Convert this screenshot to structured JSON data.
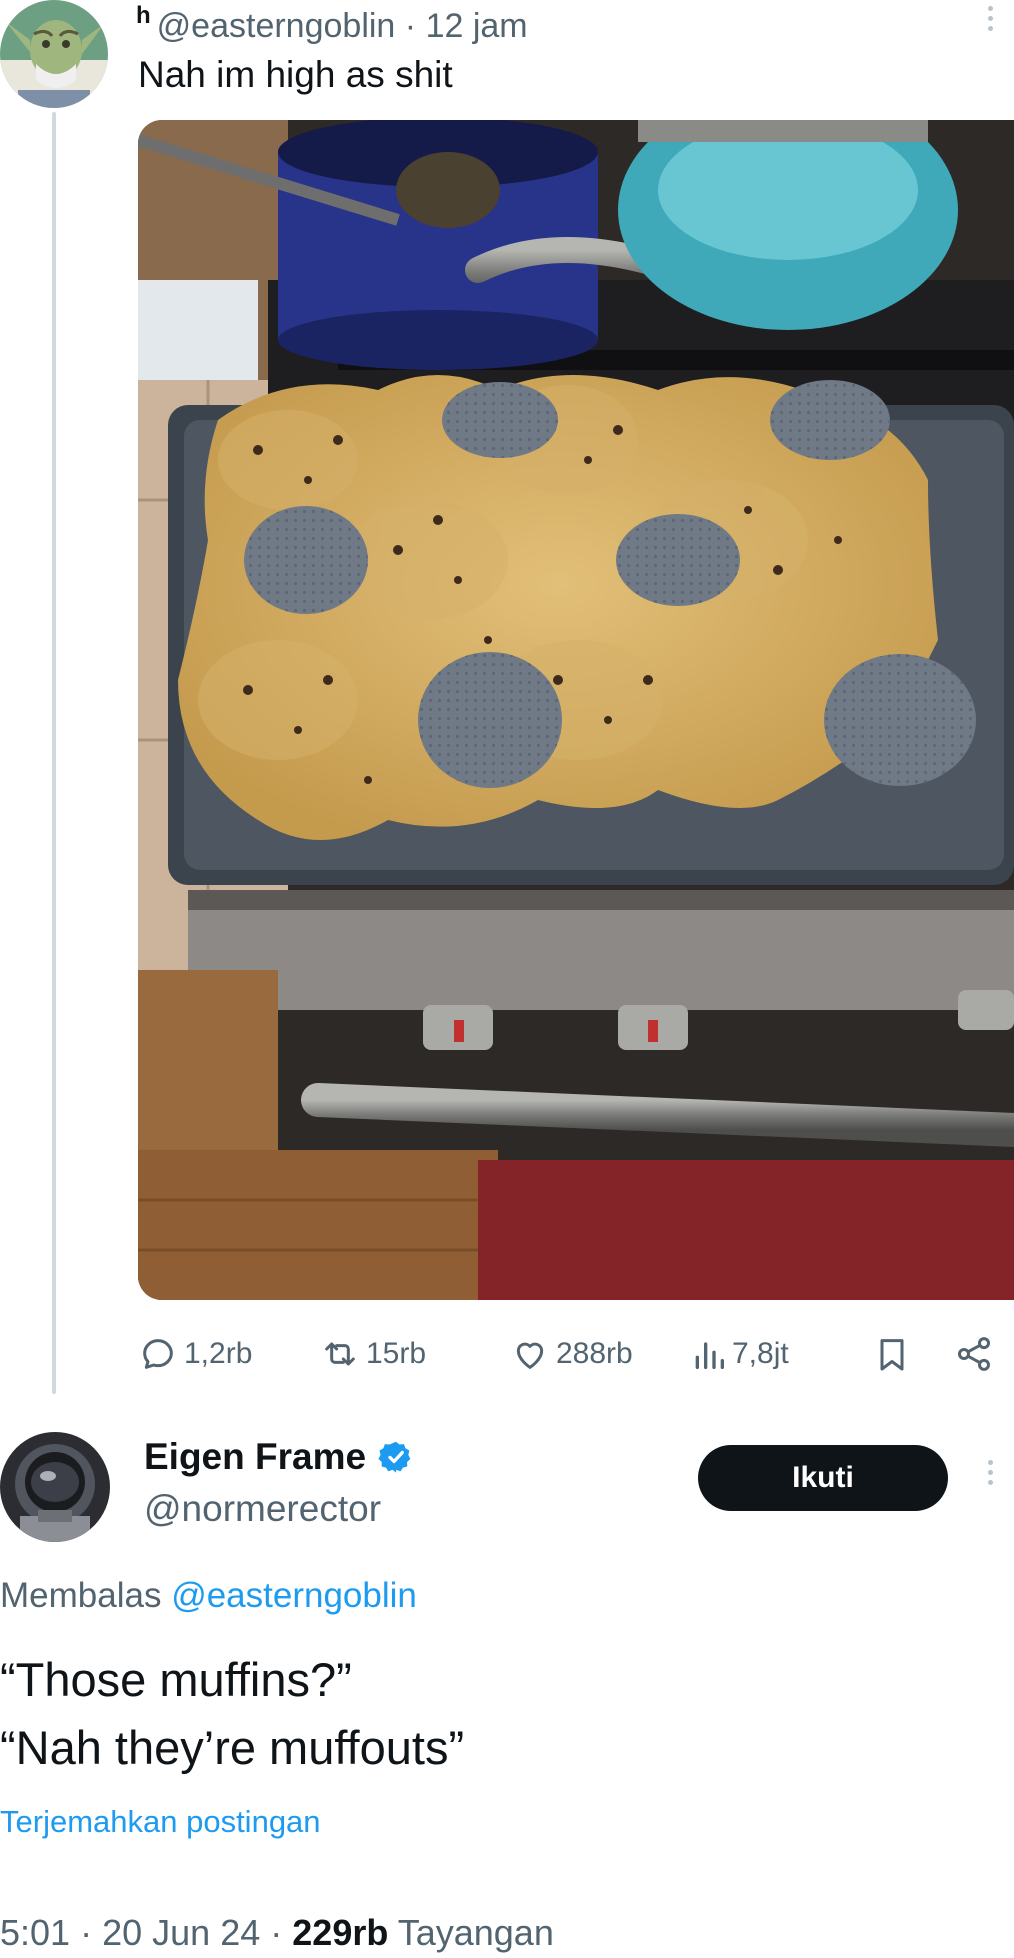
{
  "parent_tweet": {
    "name_fragment": "h",
    "handle": "@easterngoblin",
    "separator": "·",
    "time": "12 jam",
    "text": "Nah im high as shit",
    "media_alt": "photo-cookies-baked-on-upside-down-muffin-tin",
    "stats": {
      "replies": "1,2rb",
      "reposts": "15rb",
      "likes": "288rb",
      "views": "7,8jt"
    }
  },
  "reply_tweet": {
    "name": "Eigen Frame",
    "handle": "@normerector",
    "verified": true,
    "follow_label": "Ikuti",
    "replying_prefix": "Membalas",
    "replying_to": "@easterngoblin",
    "text_line1": "“Those muffins?”",
    "text_line2": "“Nah they’re muffouts”",
    "translate_label": "Terjemahkan postingan",
    "time": "5:01",
    "sep": "·",
    "date": "20 Jun 24",
    "views_count": "229rb",
    "views_label": "Tayangan"
  },
  "colors": {
    "text_primary": "#0f1419",
    "text_secondary": "#536471",
    "link": "#1d9bf0",
    "verified": "#1d9bf0",
    "button_bg": "#0f1419"
  },
  "icons": [
    "reply-icon",
    "repost-icon",
    "like-icon",
    "views-icon",
    "bookmark-icon",
    "share-icon",
    "verified-badge-icon",
    "more-icon"
  ]
}
